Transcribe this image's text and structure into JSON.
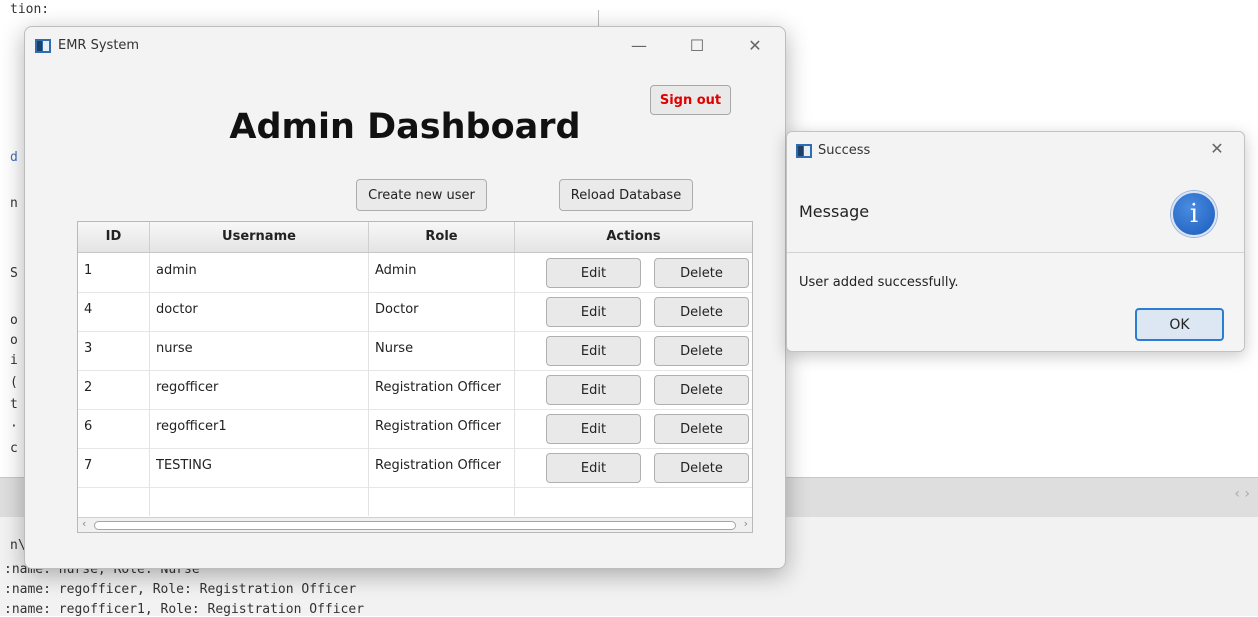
{
  "background": {
    "code_lines": [
      "tion:",
      "d",
      "n",
      "S",
      "o",
      "o",
      "i",
      "(",
      "t",
      "·",
      "c",
      "n\\"
    ],
    "console_lines": [
      ":name: nurse, Role: Nurse",
      ":name: regofficer, Role: Registration Officer",
      ":name: regofficer1, Role: Registration Officer"
    ],
    "panel_nav": "‹ ›"
  },
  "main_window": {
    "title": "EMR System",
    "controls": {
      "minimize": "—",
      "maximize": "☐",
      "close": "✕"
    },
    "signout_label": "Sign out",
    "page_title": "Admin Dashboard",
    "create_user_label": "Create new user",
    "reload_db_label": "Reload Database",
    "table": {
      "headers": [
        "ID",
        "Username",
        "Role",
        "Actions"
      ],
      "rows": [
        {
          "id": "1",
          "username": "admin",
          "role": "Admin",
          "edit": "Edit",
          "delete": "Delete"
        },
        {
          "id": "4",
          "username": "doctor",
          "role": "Doctor",
          "edit": "Edit",
          "delete": "Delete"
        },
        {
          "id": "3",
          "username": "nurse",
          "role": "Nurse",
          "edit": "Edit",
          "delete": "Delete"
        },
        {
          "id": "2",
          "username": "regofficer",
          "role": "Registration Officer",
          "edit": "Edit",
          "delete": "Delete"
        },
        {
          "id": "6",
          "username": "regofficer1",
          "role": "Registration Officer",
          "edit": "Edit",
          "delete": "Delete"
        },
        {
          "id": "7",
          "username": "TESTING",
          "role": "Registration Officer",
          "edit": "Edit",
          "delete": "Delete"
        }
      ],
      "scroll_left": "‹",
      "scroll_right": "›"
    }
  },
  "dialog": {
    "title": "Success",
    "close": "✕",
    "header_text": "Message",
    "icon_glyph": "i",
    "body_text": "User added successfully.",
    "ok_label": "OK"
  },
  "colors": {
    "signout_text": "#e00000",
    "ok_border": "#2b7cd3",
    "info_icon": "#1a5bbd"
  }
}
